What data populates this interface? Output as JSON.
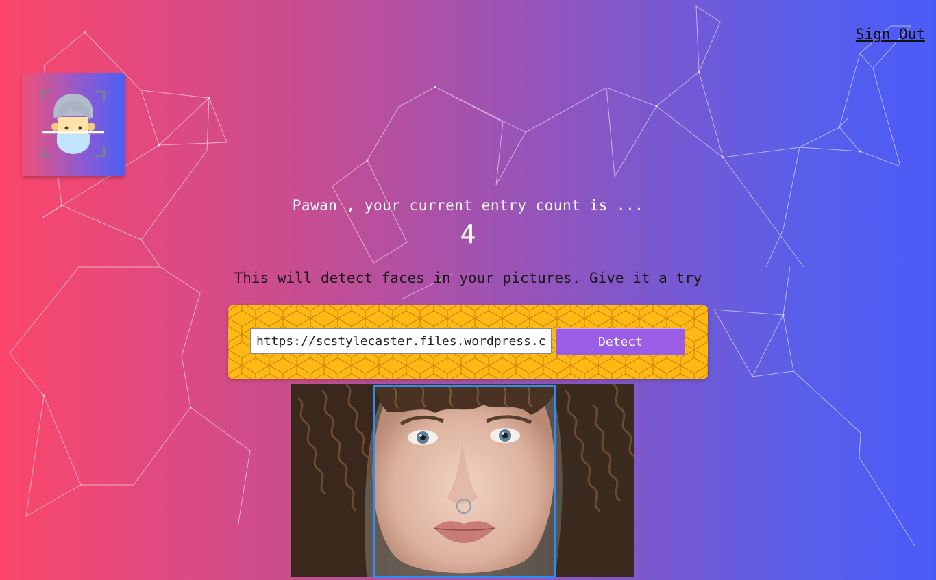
{
  "header": {
    "sign_out_label": "Sign Out"
  },
  "logo": {
    "icon": "face-scan-icon"
  },
  "rank": {
    "greeting": "Pawan , your current entry count is ...",
    "entry_count": "4"
  },
  "tagline": "This will detect faces in your pictures. Give it a try",
  "image_form": {
    "url_value": "https://scstylecaster.files.wordpress.com/",
    "detect_label": "Detect"
  },
  "result": {
    "image_alt": "curly-haired woman portrait",
    "faces_detected": 1
  },
  "colors": {
    "gradient_left": "#fb466a",
    "gradient_right": "#4a5cf8",
    "panel_yellow": "#ffb914",
    "button_purple": "#9b5de5",
    "face_box_blue": "#2f8cf0"
  }
}
